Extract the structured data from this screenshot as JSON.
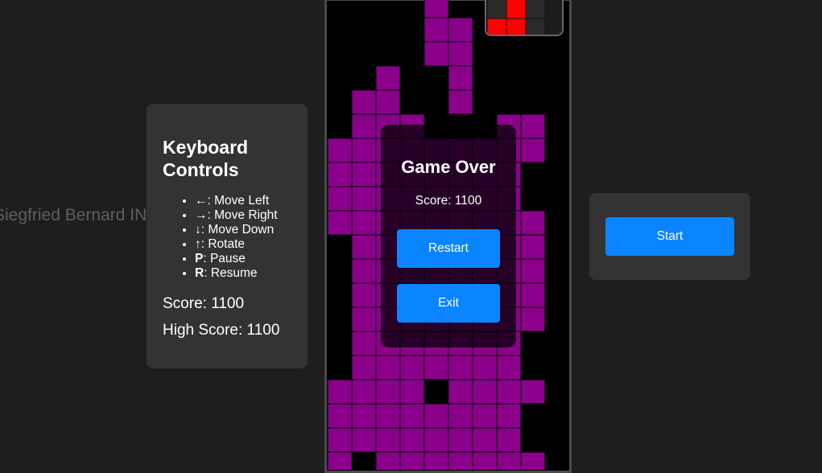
{
  "watermark": "Siegfried Bernard INACK BEI",
  "controls": {
    "title": "Keyboard Controls",
    "items": [
      {
        "key": "←",
        "action": ": Move Left"
      },
      {
        "key": "→",
        "action": ": Move Right"
      },
      {
        "key": "↓",
        "action": ": Move Down"
      },
      {
        "key": "↑",
        "action": ": Rotate"
      },
      {
        "key": "P",
        "action": ": Pause"
      },
      {
        "key": "R",
        "action": ": Resume"
      }
    ],
    "score": "Score: 1100",
    "high_score": "High Score: 1100"
  },
  "game_over": {
    "title": "Game Over",
    "score": "Score: 1100",
    "restart_label": "Restart",
    "exit_label": "Exit"
  },
  "start_label": "Start",
  "colors": {
    "block": "#8b008b",
    "next_piece": "#ff0000",
    "button": "#0a84ff",
    "panel": "#333333",
    "background": "#1e1e1e"
  },
  "board": {
    "rows": [
      "....X....",
      "....XX...",
      "....XX...",
      "..X..X...",
      ".XX..X...",
      ".XXX...XX",
      "XXXXXXXXX",
      "XXXXXXXX.",
      "XXXXXXXX.",
      "XXXXXXXXX",
      ".XXXXXXXX",
      ".XXXXXXXX",
      ".XXXXXXXX",
      ".XXXXXXXX",
      ".XXXXXXX.",
      ".XXXXXXX.",
      "XXXX.XXXX",
      "XXXXXXXX.",
      "XXXXXXXX.",
      "X.XXXXXXX"
    ]
  },
  "next_piece": {
    "rows": [
      ".X.",
      "XX."
    ]
  }
}
